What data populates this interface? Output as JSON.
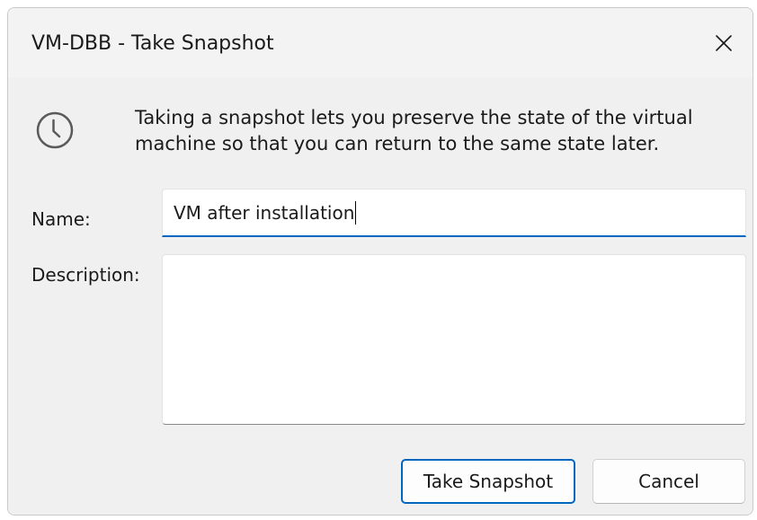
{
  "window": {
    "title": "VM-DBB - Take Snapshot",
    "close_icon": "close-icon"
  },
  "info": {
    "icon": "clock-icon",
    "text": "Taking a snapshot lets you preserve the state of the virtual machine so that you can return to the same state later."
  },
  "form": {
    "name_label": "Name:",
    "name_value": "VM after installation",
    "description_label": "Description:",
    "description_value": ""
  },
  "buttons": {
    "take_snapshot": "Take Snapshot",
    "cancel": "Cancel"
  },
  "colors": {
    "accent": "#0067c0",
    "dialog_bg": "#f0f0f0",
    "titlebar_bg": "#f3f3f3"
  }
}
